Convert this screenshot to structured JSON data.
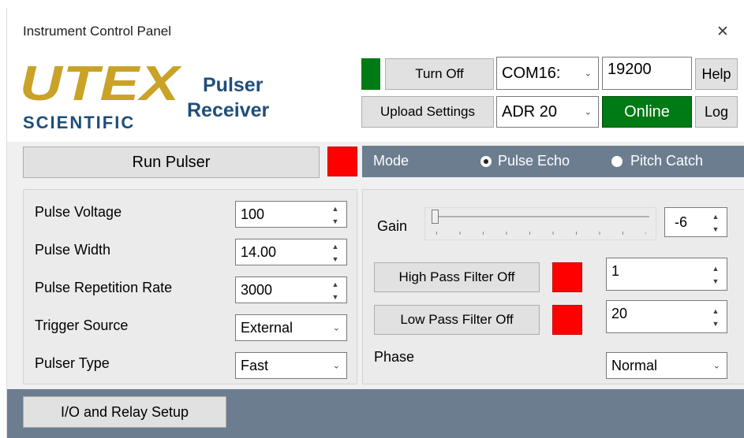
{
  "window": {
    "title": "Instrument Control Panel",
    "close_icon": "close-icon"
  },
  "logo": {
    "brand": "UTEX",
    "subtitle": "SCIENTIFIC"
  },
  "product": {
    "line1": "Pulser",
    "line2": "Receiver"
  },
  "connection": {
    "turn_off_label": "Turn Off",
    "com_port": "COM16:",
    "baud_rate": "19200",
    "help_label": "Help",
    "upload_label": "Upload Settings",
    "address": "ADR 20",
    "status": "Online",
    "log_label": "Log",
    "status_color": "#007a14",
    "power_indicator_color": "#007a14"
  },
  "pulser": {
    "run_label": "Run Pulser",
    "run_indicator_color": "#ff0000",
    "fields": [
      {
        "label": "Pulse Voltage",
        "value": "100",
        "kind": "spin"
      },
      {
        "label": "Pulse Width",
        "value": "14.00",
        "kind": "spin"
      },
      {
        "label": "Pulse Repetition Rate",
        "value": "3000",
        "kind": "spin"
      },
      {
        "label": "Trigger Source",
        "value": "External",
        "kind": "combo"
      },
      {
        "label": "Pulser Type",
        "value": "Fast",
        "kind": "combo"
      }
    ]
  },
  "receiver": {
    "mode_label": "Mode",
    "modes": [
      {
        "label": "Pulse Echo",
        "selected": true
      },
      {
        "label": "Pitch Catch",
        "selected": false
      }
    ],
    "gain_label": "Gain",
    "gain_value": "-6",
    "gain_slider_fraction": 0.0,
    "high_pass_label": "High Pass Filter Off",
    "high_pass_value": "1",
    "low_pass_label": "Low Pass Filter Off",
    "low_pass_value": "20",
    "phase_label": "Phase",
    "phase_value": "Normal",
    "filter_indicator_color": "#ff0000"
  },
  "footer": {
    "io_relay_label": "I/O and Relay Setup"
  }
}
